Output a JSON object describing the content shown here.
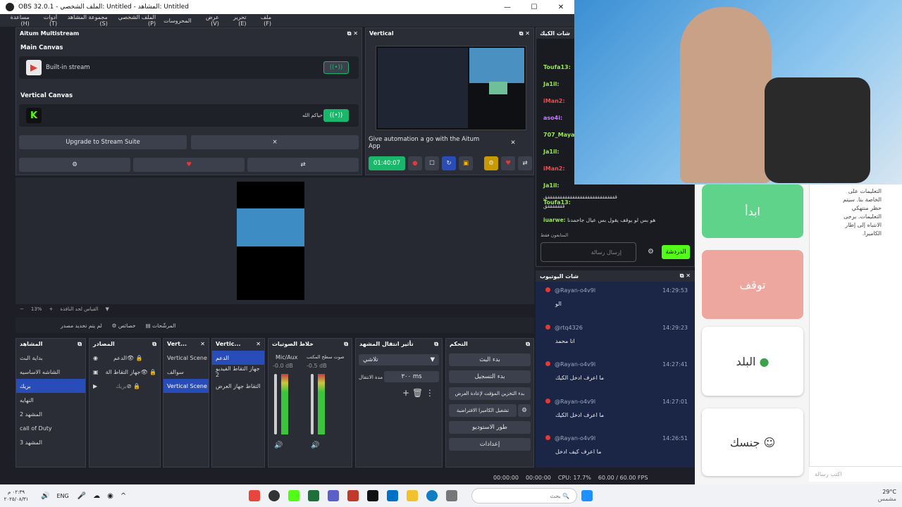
{
  "window": {
    "title": "OBS 32.0.1 - الملف الشخصي: Untitled - المشاهد: Untitled"
  },
  "menu": [
    "ملف (F)",
    "تحرير (E)",
    "عرض (V)",
    "المحروسات",
    "الملف الشخصي (P)",
    "مجموعة المشاهد (S)",
    "أدوات (T)",
    "مساعدة (H)"
  ],
  "aitum": {
    "title": "Aitum Multistream",
    "main_canvas": "Main Canvas",
    "builtin": "Built-in stream",
    "vertical_canvas": "Vertical Canvas",
    "vert_label": "حياكم الله",
    "upgrade": "Upgrade to Stream Suite",
    "close": "×"
  },
  "vertical": {
    "title": "Vertical",
    "promo": "Give automation a go with the Aitum App",
    "timer": "01:40:07"
  },
  "preview": {
    "zoom": "13%",
    "scale_label": "القياس لحد النافذة",
    "no_source": "لم يتم تحديد مصدر",
    "props": "خصائص",
    "filters": "المرشّحات"
  },
  "scenes": {
    "title": "المشاهد",
    "items": [
      "بداية البث",
      "الشاشه الاساسيه",
      "بريك",
      "النهايه",
      "المشهد 2",
      "call of Duty",
      "المشهد 3"
    ],
    "selected": 2
  },
  "sources": {
    "title": "المصادر",
    "items": [
      "الدعم",
      "جهاز التقاط الة",
      "بريك"
    ]
  },
  "vert1": {
    "title": "Vert...",
    "items": [
      "Vertical Scene",
      "سوالف",
      "Vertical Scene"
    ]
  },
  "vert2": {
    "title": "Vertic...",
    "items": [
      "الدعم",
      "جهاز التقاط الفيديو 2",
      "التقاط جهاز العرض"
    ]
  },
  "mixer": {
    "title": "خلاط الصوتيات",
    "ch1": "Mic/Aux",
    "ch1db": "-0.0 dB",
    "ch2": "صوت سطح المكتب",
    "ch2db": "-0.5 dB",
    "scale": [
      "0",
      "-5",
      "-10",
      "-15",
      "-20",
      "-25",
      "-30",
      "-35",
      "-40",
      "-45",
      "-50",
      "-55",
      "-60"
    ]
  },
  "transitions": {
    "title": "تأثير انتقال المشهد",
    "type": "تلاشي",
    "duration_label": "مدة الانتقال",
    "duration": "٣٠٠ ms"
  },
  "controls": {
    "title": "التحكم",
    "buttons": [
      "بدء البث",
      "بدء التسجيل",
      "بدء التخزين المؤقت لإعادة العرض",
      "تشغيل الكاميرا الافتراضية",
      "طور الاستوديو",
      "إعدادات"
    ]
  },
  "status": {
    "t1": "00:00:00",
    "t2": "00:00:00",
    "cpu": "CPU: 17.7%",
    "fps": "60.00 / 60.00 FPS"
  },
  "kickchat": {
    "title": "شات الكيك",
    "users": [
      "Toufa13:",
      "Ja1il:",
      "iMan2:",
      "aso4i:",
      "707_Mayar",
      "Ja1il:",
      "iMan2:",
      "Ja1il:",
      "Toufa13:"
    ],
    "long1": "ققققققققققققققققققققققققققققق",
    "long2": "قققققققق",
    "last_user": "iuarwe:",
    "last_msg": "هو بس لو يوقف يقول بس عيال جاحمدنا",
    "followers": "المتابعون فقط",
    "input": "إرسال رسالة",
    "send": "الدردشة"
  },
  "ytchat": {
    "title": "شات اليوتيوب",
    "messages": [
      {
        "user": "@Rayan-o4v9l",
        "time": "14:29:53",
        "msg": "الو"
      },
      {
        "user": "@rtq4326",
        "time": "14:29:23",
        "msg": "انا محمد"
      },
      {
        "user": "@Rayan-o4v9l",
        "time": "14:27:41",
        "msg": "ما اعرف ادخل الكيك"
      },
      {
        "user": "@Rayan-o4v9l",
        "time": "14:27:01",
        "msg": "ما اعرف ادخل الكيك"
      },
      {
        "user": "@Rayan-o4v9l",
        "time": "14:26:51",
        "msg": "ما اعرف كيف ادخل"
      }
    ]
  },
  "cards": {
    "start": "ابدأ",
    "stop": "توقف",
    "country": "البلد",
    "gender": "جنسك"
  },
  "side": {
    "text": "التعليمات على الخاصة بنا. سيتم حظر منتهكي التعليمات. يرجى الانتباه إلى إطار الكاميرا.",
    "input": "اكتب رسالة"
  },
  "taskbar": {
    "lang": "ENG",
    "search": "بحث",
    "time": "٠٢:٣٩ م",
    "date": "٢٠٢٥/٠٨/٣١",
    "temp": "29°C",
    "weather": "مشمس"
  },
  "colors": {
    "accent": "#284cb8",
    "kick": "#53fc18",
    "green": "#18b76a"
  }
}
